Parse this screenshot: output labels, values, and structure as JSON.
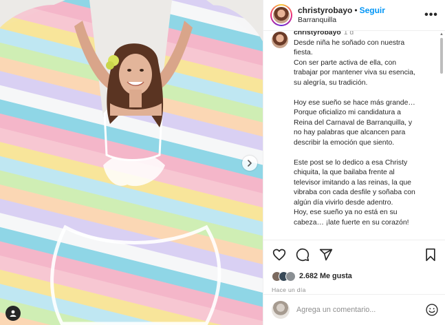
{
  "post": {
    "username": "christyrobayo",
    "separator": "•",
    "follow_label": "Seguir",
    "location": "Barranquilla",
    "more_label": "•••"
  },
  "caption": {
    "username": "christyrobayo",
    "time": "1 d",
    "lines": [
      "Desde niña he soñado con nuestra",
      "fiesta.",
      "Con ser parte activa de ella, con",
      "trabajar por mantener viva su esencia,",
      "su alegría, su tradición.",
      "",
      "Hoy ese sueño se hace más grande…",
      "Porque oficializo mi candidatura a",
      "Reina del Carnaval de Barranquilla, y",
      "no hay palabras que alcancen para",
      "describir la emoción que siento.",
      "",
      "Este post se lo dedico a esa Christy",
      "chiquita, la que bailaba frente al",
      "televisor imitando a las reinas, la que",
      "vibraba con cada desfile y soñaba con",
      "algún día vivirlo desde adentro.",
      "Hoy, ese sueño ya no está en su",
      "cabeza… ¡late fuerte en su corazón!"
    ]
  },
  "engagement": {
    "likes": "2.682 Me gusta",
    "posted_ago": "Hace un día"
  },
  "comment_box": {
    "placeholder": "Agrega un comentario..."
  },
  "icons": [
    "heart-icon",
    "comment-icon",
    "share-icon",
    "save-icon",
    "emoji-icon",
    "next-arrow-icon",
    "user-tag-icon",
    "more-options-icon"
  ],
  "colors": {
    "follow_blue": "#0095f6",
    "text": "#262626",
    "muted": "#8e8e8e"
  }
}
